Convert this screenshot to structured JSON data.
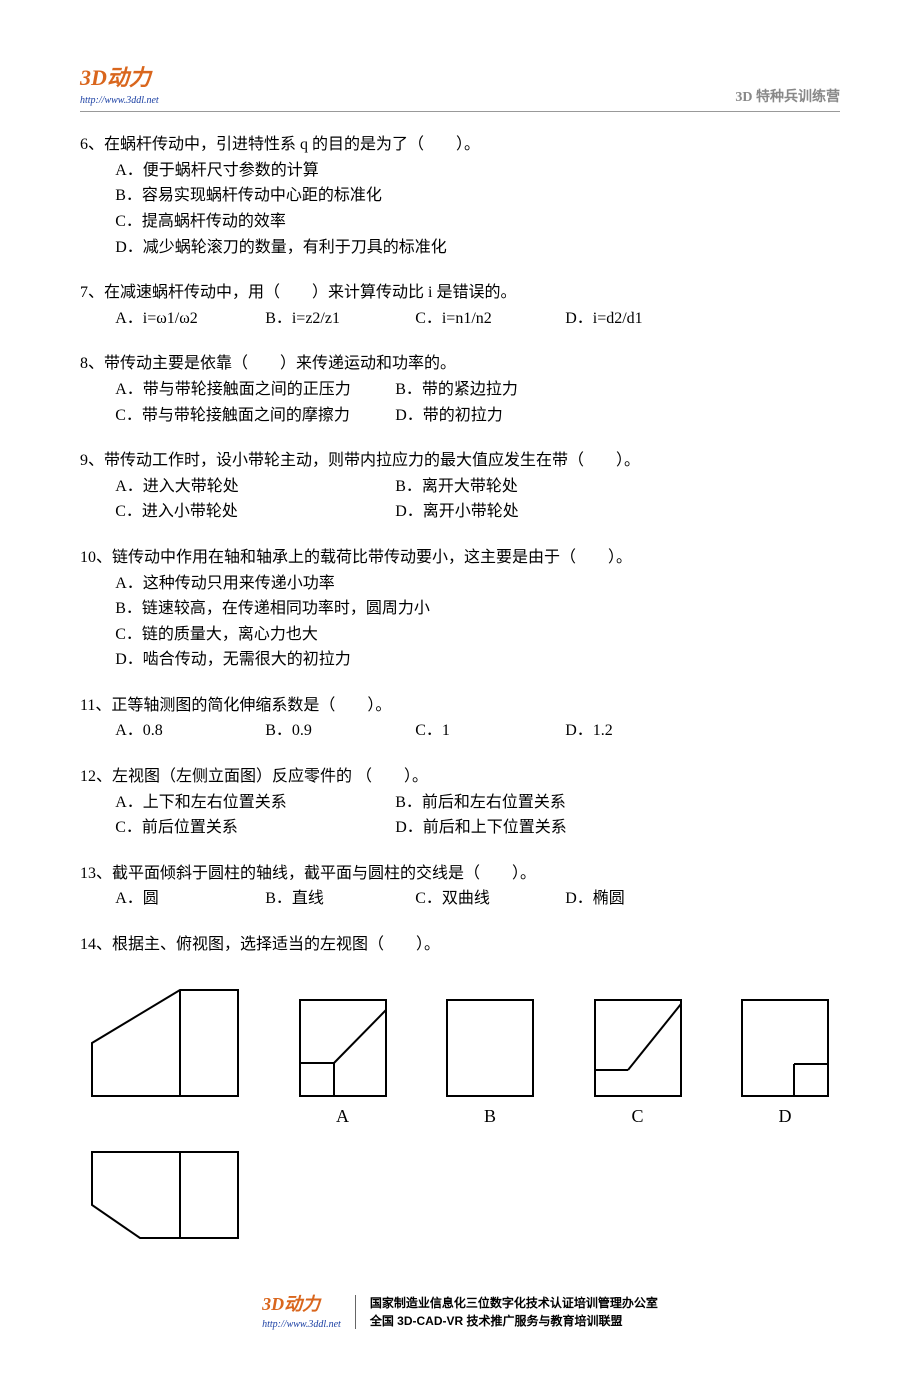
{
  "header": {
    "logo_3d": "3D",
    "logo_dongli": "动力",
    "logo_url": "http://www.3ddl.net",
    "right_text": "3D 特种兵训练营"
  },
  "questions": {
    "q6": {
      "stem": "6、在蜗杆传动中，引进特性系 q 的目的是为了（　　）。",
      "A": "A．便于蜗杆尺寸参数的计算",
      "B": "B．容易实现蜗杆传动中心距的标准化",
      "C": "C．提高蜗杆传动的效率",
      "D": "D．减少蜗轮滚刀的数量，有利于刀具的标准化"
    },
    "q7": {
      "stem": "7、在减速蜗杆传动中，用（　　）来计算传动比 i 是错误的。",
      "A": "A．i=ω1/ω2",
      "B": "B．i=z2/z1",
      "C": "C．i=n1/n2",
      "D": "D．i=d2/d1"
    },
    "q8": {
      "stem": "8、带传动主要是依靠（　　）来传递运动和功率的。",
      "A": "A．带与带轮接触面之间的正压力",
      "B": "B．带的紧边拉力",
      "C": "C．带与带轮接触面之间的摩擦力",
      "D": "D．带的初拉力"
    },
    "q9": {
      "stem": "9、带传动工作时，设小带轮主动，则带内拉应力的最大值应发生在带（　　）。",
      "A": "A．进入大带轮处",
      "B": "B．离开大带轮处",
      "C": "C．进入小带轮处",
      "D": "D．离开小带轮处"
    },
    "q10": {
      "stem": "10、链传动中作用在轴和轴承上的载荷比带传动要小，这主要是由于（　　）。",
      "A": "A．这种传动只用来传递小功率",
      "B": "B．链速较高，在传递相同功率时，圆周力小",
      "C": "C．链的质量大，离心力也大",
      "D": "D．啮合传动，无需很大的初拉力"
    },
    "q11": {
      "stem": "11、正等轴测图的简化伸缩系数是（　　）。",
      "A": "A．0.8",
      "B": "B．0.9",
      "C": "C．1",
      "D": "D．1.2"
    },
    "q12": {
      "stem": "12、左视图（左侧立面图）反应零件的 （　　）。",
      "A": "A．上下和左右位置关系",
      "B": "B．前后和左右位置关系",
      "C": "C．前后位置关系",
      "D": "D．前后和上下位置关系"
    },
    "q13": {
      "stem": "13、截平面倾斜于圆柱的轴线，截平面与圆柱的交线是（　　）。",
      "A": "A．圆",
      "B": "B．直线",
      "C": "C．双曲线",
      "D": "D．椭圆"
    },
    "q14": {
      "stem": "14、根据主、俯视图，选择适当的左视图（　　）。",
      "labels": {
        "A": "A",
        "B": "B",
        "C": "C",
        "D": "D"
      }
    }
  },
  "footer": {
    "logo_3d": "3D",
    "logo_dongli": "动力",
    "logo_url": "http://www.3ddl.net",
    "line1": "国家制造业信息化三位数字化技术认证培训管理办公室",
    "line2": "全国 3D-CAD-VR 技术推广服务与教育培训联盟"
  }
}
